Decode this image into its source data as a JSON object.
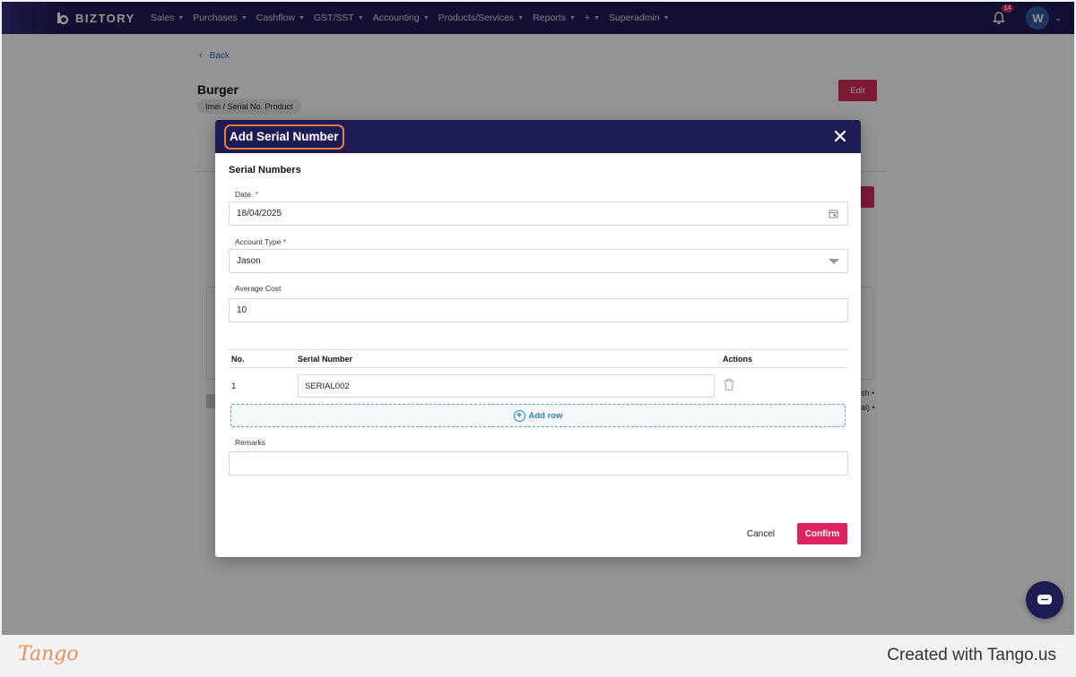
{
  "nav": {
    "brand": "BIZTORY",
    "items": [
      {
        "label": "Sales"
      },
      {
        "label": "Purchases"
      },
      {
        "label": "Cashflow"
      },
      {
        "label": "GST/SST"
      },
      {
        "label": "Accounting"
      },
      {
        "label": "Products/Services"
      },
      {
        "label": "Reports"
      }
    ],
    "plus": "+",
    "superadmin": "Superadmin",
    "notification_count": "14",
    "avatar_initial": "W"
  },
  "page": {
    "back": "Back",
    "product_title": "Burger",
    "product_type": "Imei / Serial No. Product",
    "edit": "Edit",
    "ghost_text_1": "sh •",
    "ghost_text_2": "ai) •"
  },
  "modal": {
    "title": "Add Serial Number",
    "section": "Serial Numbers",
    "date_label": "Date.",
    "date_value": "18/04/2025",
    "account_type_label": "Account Type",
    "account_type_value": "Jason",
    "average_cost_label": "Average Cost",
    "average_cost_value": "10",
    "table": {
      "headers": {
        "no": "No.",
        "serial": "Serial Number",
        "actions": "Actions"
      },
      "rows": [
        {
          "no": "1",
          "serial": "SERIAL002"
        }
      ]
    },
    "add_row": "Add row",
    "remarks_label": "Remarks",
    "remarks_value": "",
    "required_mark": "*",
    "cancel": "Cancel",
    "confirm": "Confirm"
  },
  "footer": {
    "logo": "Tango",
    "credit": "Created with Tango.us"
  },
  "colors": {
    "nav_bg": "#1e1c55",
    "accent": "#e0245e",
    "highlight": "#f47a3c",
    "link": "#2f7fb8"
  }
}
